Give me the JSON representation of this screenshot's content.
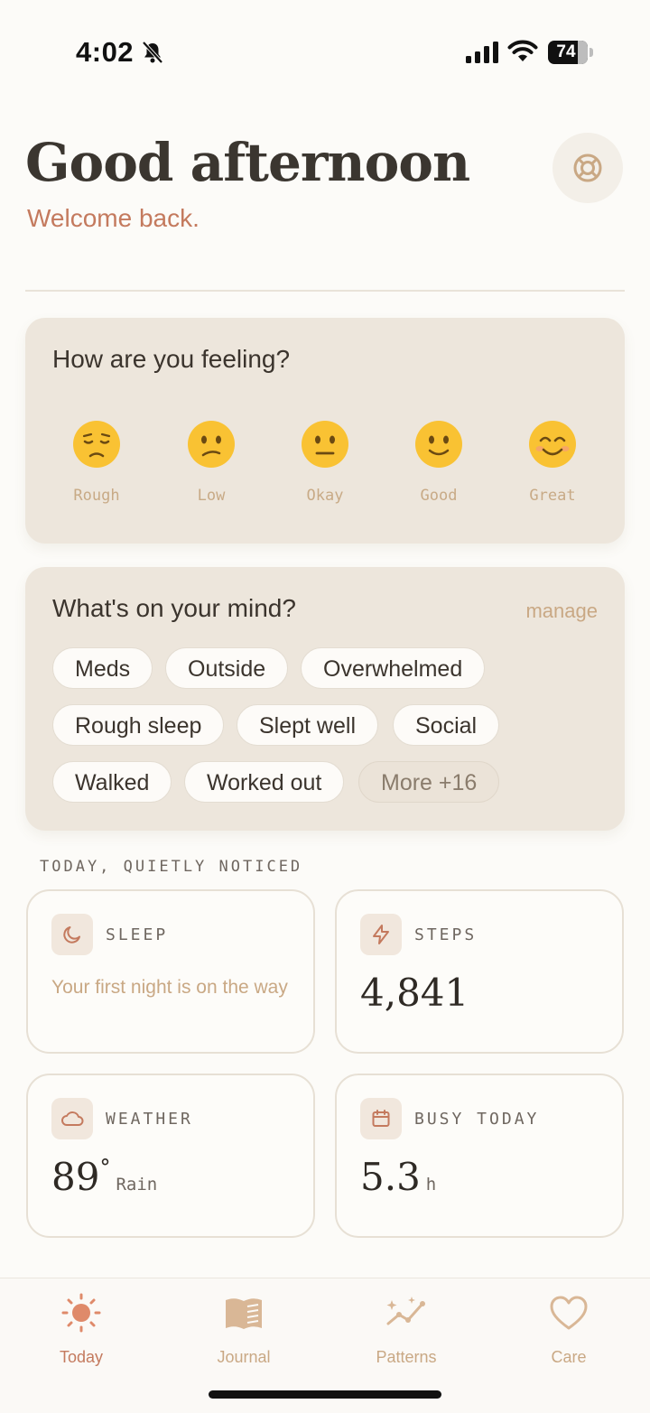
{
  "status_bar": {
    "time": "4:02",
    "battery": "74",
    "battery_level": 0.74
  },
  "header": {
    "greeting": "Good afternoon",
    "subtitle": "Welcome back."
  },
  "mood": {
    "title": "How are you feeling?",
    "options": [
      {
        "label": "Rough",
        "emoji": "pensive-face"
      },
      {
        "label": "Low",
        "emoji": "confused-face"
      },
      {
        "label": "Okay",
        "emoji": "neutral-face"
      },
      {
        "label": "Good",
        "emoji": "slightly-smiling-face"
      },
      {
        "label": "Great",
        "emoji": "smiling-face-with-smiling-eyes"
      }
    ]
  },
  "mind": {
    "title": "What's on your mind?",
    "manage_label": "manage",
    "tags": [
      "Meds",
      "Outside",
      "Overwhelmed",
      "Rough sleep",
      "Slept well",
      "Social",
      "Walked",
      "Worked out"
    ],
    "more_label": "More +16"
  },
  "section_label": "TODAY, QUIETLY NOTICED",
  "tiles": {
    "sleep": {
      "label": "SLEEP",
      "note": "Your first night is on the way",
      "icon": "moon-icon"
    },
    "steps": {
      "label": "STEPS",
      "value": "4,841",
      "icon": "bolt-icon"
    },
    "weather": {
      "label": "WEATHER",
      "value": "89",
      "degree": "°",
      "unit": "Rain",
      "icon": "cloud-icon"
    },
    "busy": {
      "label": "BUSY TODAY",
      "value": "5.3",
      "unit": "h",
      "icon": "calendar-icon"
    }
  },
  "nav": {
    "items": [
      {
        "label": "Today",
        "icon": "sun-icon",
        "active": true
      },
      {
        "label": "Journal",
        "icon": "book-icon",
        "active": false
      },
      {
        "label": "Patterns",
        "icon": "sparkle-chart-icon",
        "active": false
      },
      {
        "label": "Care",
        "icon": "heart-icon",
        "active": false
      }
    ]
  },
  "colors": {
    "background": "#fcfbf8",
    "card": "#ede6dc",
    "accent": "#c47a5e",
    "muted": "#c9a884",
    "text": "#3b342d"
  }
}
